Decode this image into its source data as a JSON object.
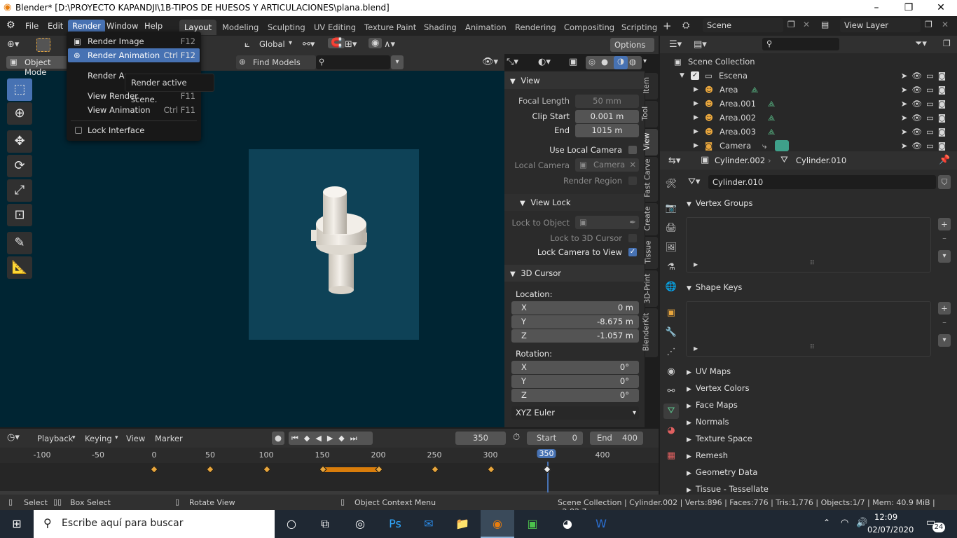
{
  "window": {
    "title": "Blender* [D:\\PROYECTO KAPANDJI\\1B-TIPOS DE HUESOS Y ARTICULACIONES\\plana.blend]"
  },
  "menu": [
    "File",
    "Edit",
    "Render",
    "Window",
    "Help"
  ],
  "workspaces": [
    "Layout",
    "Modeling",
    "Sculpting",
    "UV Editing",
    "Texture Paint",
    "Shading",
    "Animation",
    "Rendering",
    "Compositing",
    "Scripting"
  ],
  "scene": {
    "name": "Scene",
    "view_layer": "View Layer"
  },
  "render_menu": {
    "items": [
      {
        "label": "Render Image",
        "shortcut": "F12"
      },
      {
        "label": "Render Animation",
        "shortcut": "Ctrl F12"
      },
      {
        "label": "Render Au",
        "shortcut": ""
      },
      {
        "label": "View Render",
        "shortcut": "F11"
      },
      {
        "label": "View Animation",
        "shortcut": "Ctrl F11"
      },
      {
        "label": "Lock Interface",
        "shortcut": ""
      }
    ],
    "tooltip": "Render active scene."
  },
  "viewport_header": {
    "mode": "Object Mode",
    "orientation": "Global",
    "options": "Options",
    "find_models": "Find Models"
  },
  "npanel": {
    "view": {
      "title": "View",
      "focal_length_label": "Focal Length",
      "focal_length": "50 mm",
      "clip_start_label": "Clip Start",
      "clip_start": "0.001 m",
      "end_label": "End",
      "end": "1015 m",
      "use_local_camera": "Use Local Camera",
      "local_camera_label": "Local Camera",
      "local_camera": "Camera",
      "render_region": "Render Region"
    },
    "view_lock": {
      "title": "View Lock",
      "lock_to_object": "Lock to Object",
      "lock_to_3d_cursor": "Lock to 3D Cursor",
      "lock_camera_to_view": "Lock Camera to View"
    },
    "cursor": {
      "title": "3D Cursor",
      "location_label": "Location:",
      "x_label": "X",
      "x": "0 m",
      "y_label": "Y",
      "y": "-8.675 m",
      "z_label": "Z",
      "z": "-1.057 m",
      "rotation_label": "Rotation:",
      "rx": "0°",
      "ry": "0°",
      "rz": "0°",
      "mode": "XYZ Euler"
    },
    "tabs": [
      "Item",
      "Tool",
      "View",
      "Fast Carve",
      "Create",
      "Tissue",
      "3D-Print",
      "BlenderKit"
    ]
  },
  "outliner": {
    "root": "Scene Collection",
    "collection": "Escena",
    "items": [
      "Area",
      "Area.001",
      "Area.002",
      "Area.003",
      "Camera"
    ]
  },
  "properties": {
    "object": "Cylinder.002",
    "mesh": "Cylinder.010",
    "mesh_field": "Cylinder.010",
    "sections_open": [
      "Vertex Groups",
      "Shape Keys"
    ],
    "sections_closed": [
      "UV Maps",
      "Vertex Colors",
      "Face Maps",
      "Normals",
      "Texture Space",
      "Remesh",
      "Geometry Data",
      "Tissue - Tessellate"
    ]
  },
  "timeline": {
    "menus": [
      "Playback",
      "Keying",
      "View",
      "Marker"
    ],
    "current_frame": "350",
    "start_label": "Start",
    "start": "0",
    "end_label": "End",
    "end": "400",
    "ticks": [
      "-100",
      "-50",
      "0",
      "50",
      "100",
      "150",
      "200",
      "250",
      "300",
      "350",
      "400"
    ]
  },
  "statusbar": {
    "select": "Select",
    "box_select": "Box Select",
    "rotate_view": "Rotate View",
    "context_menu": "Object Context Menu",
    "info": "Scene Collection | Cylinder.002 | Verts:896 | Faces:776 | Tris:1,776 | Objects:1/7 | Mem: 40.9 MiB | v2.82.7"
  },
  "taskbar": {
    "search_placeholder": "Escribe aquí para buscar",
    "time": "12:09",
    "date": "02/07/2020",
    "notifications": "24"
  }
}
